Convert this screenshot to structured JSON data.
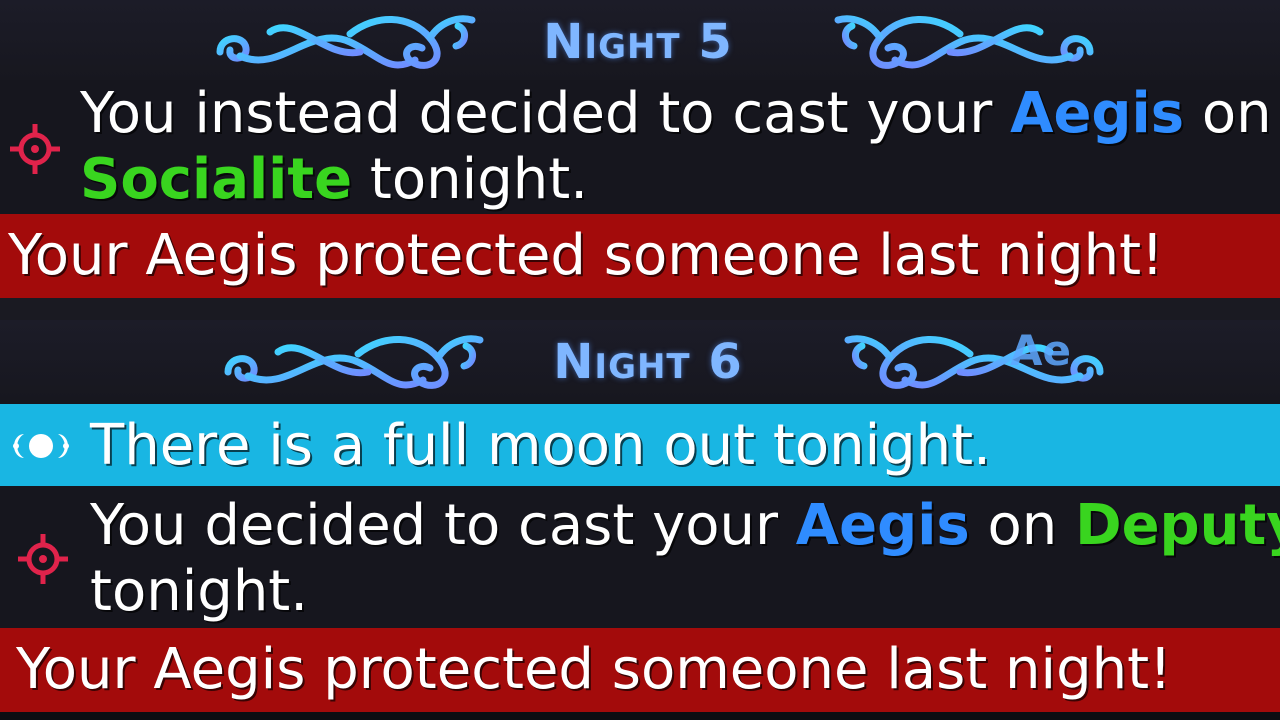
{
  "nights": [
    {
      "title": "Night 5",
      "messages": [
        {
          "type": "action",
          "parts": [
            "You instead decided to cast your ",
            "Aegis",
            " on",
            "Socialite",
            " tonight."
          ]
        },
        {
          "type": "alert",
          "text": "Your Aegis protected someone last night!"
        }
      ]
    },
    {
      "title": "Night 6",
      "overlay_text": "Ae",
      "messages": [
        {
          "type": "event",
          "text": "There is a full moon out tonight."
        },
        {
          "type": "action",
          "parts": [
            "You decided to cast your ",
            "Aegis",
            " on ",
            "Deputy",
            "tonight."
          ]
        },
        {
          "type": "alert",
          "text": "Your Aegis protected someone last night!"
        }
      ]
    }
  ],
  "colors": {
    "ability": "#2f8cff",
    "player": "#39d51f",
    "alert_bg": "#a30b0b",
    "event_bg": "#19b6e3",
    "header_text": "#7fb6ff"
  },
  "icons": {
    "action": "crosshair-target-icon",
    "event": "full-moon-icon",
    "header": "ornamental-flourish-icon"
  }
}
